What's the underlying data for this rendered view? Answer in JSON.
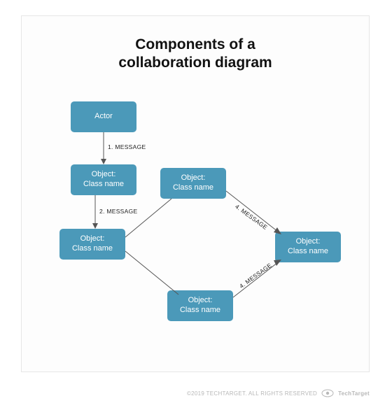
{
  "title_line1": "Components of a",
  "title_line2": "collaboration diagram",
  "nodes": {
    "actor": "Actor",
    "obj_a": "Object:\nClass name",
    "obj_b": "Object:\nClass name",
    "obj_c": "Object:\nClass name",
    "obj_d": "Object:\nClass name",
    "obj_e": "Object:\nClass name"
  },
  "messages": {
    "m1": "1. MESSAGE",
    "m2": "2. MESSAGE",
    "m4a": "4. MESSAGE",
    "m4b": "4. MESSAGE"
  },
  "footer": {
    "brand": "TechTarget",
    "copyright": "©2019 TECHTARGET. ALL RIGHTS RESERVED"
  },
  "colors": {
    "node_fill": "#4b99b9",
    "node_text": "#ffffff",
    "line": "#555555"
  }
}
